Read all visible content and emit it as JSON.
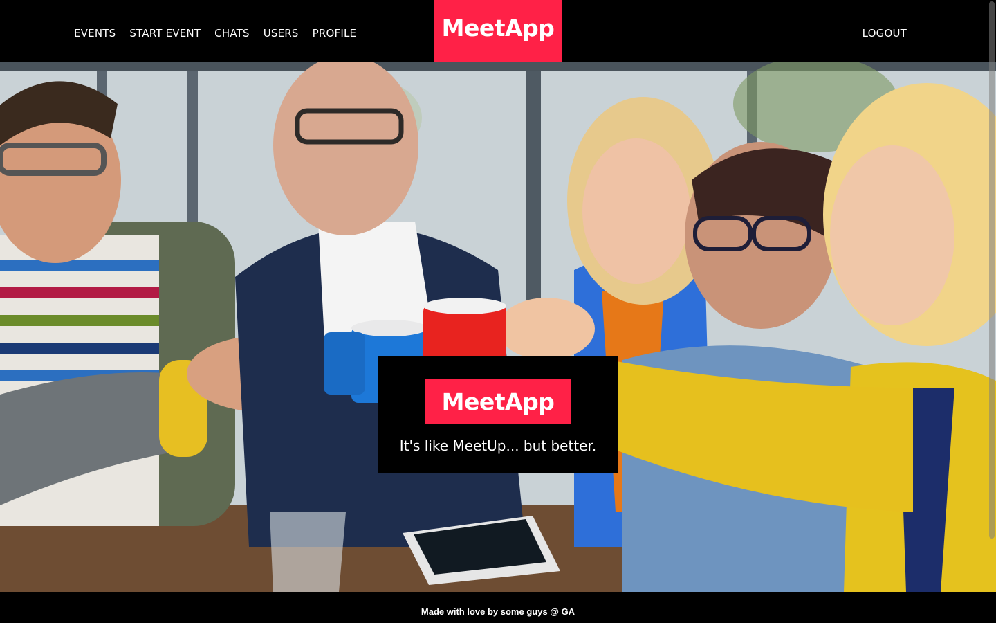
{
  "nav": {
    "links": [
      {
        "label": "EVENTS"
      },
      {
        "label": "START EVENT"
      },
      {
        "label": "CHATS"
      },
      {
        "label": "USERS"
      },
      {
        "label": "PROFILE"
      }
    ],
    "brand": "MeetApp",
    "logout": "LOGOUT"
  },
  "hero": {
    "logo": "MeetApp",
    "tagline": "It's like MeetUp... but better.",
    "image_subject": "friends-toasting-mugs-photo"
  },
  "footer": {
    "text": "Made with love by some guys @ GA"
  },
  "colors": {
    "brand": "#ff2147",
    "background": "#000000",
    "text": "#ffffff"
  }
}
